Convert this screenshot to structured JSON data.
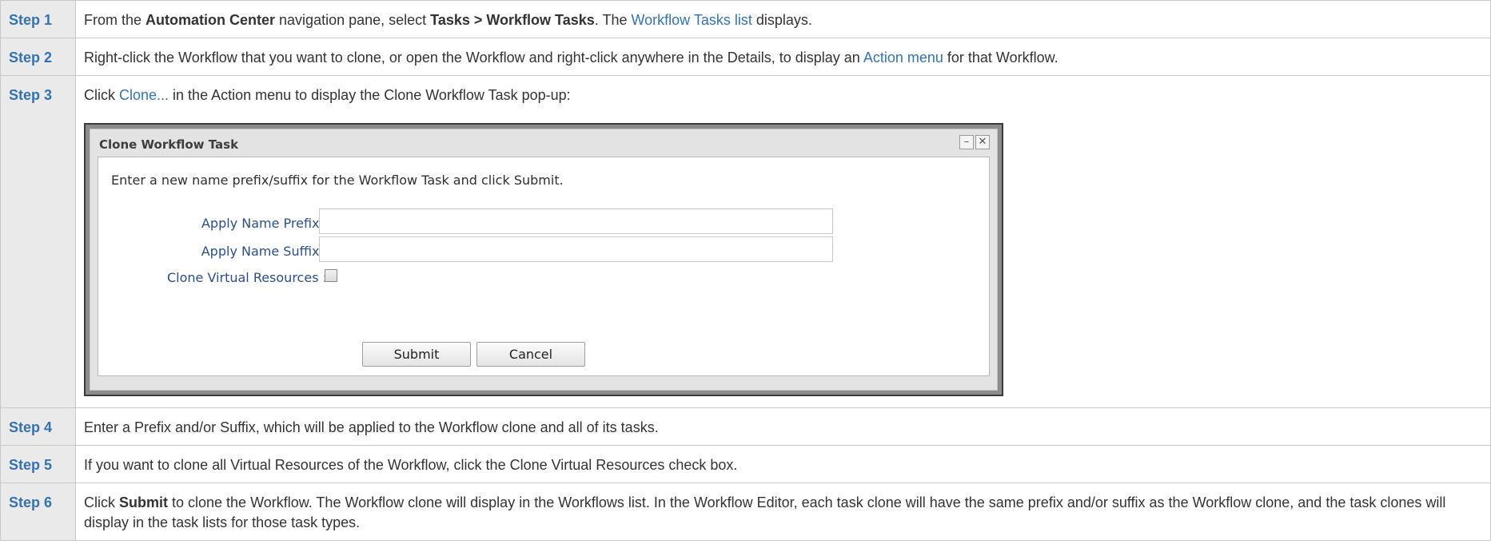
{
  "steps": [
    {
      "label": "Step 1",
      "parts": [
        {
          "t": "From the "
        },
        {
          "t": "Automation Center",
          "b": true
        },
        {
          "t": " navigation pane, select "
        },
        {
          "t": "Tasks > Workflow Tasks",
          "b": true
        },
        {
          "t": ". The "
        },
        {
          "t": "Workflow Tasks list",
          "link": true
        },
        {
          "t": " displays."
        }
      ]
    },
    {
      "label": "Step 2",
      "parts": [
        {
          "t": "Right-click the Workflow that you want to clone, or open the Workflow and right-click anywhere in the Details, to display an "
        },
        {
          "t": "Action menu",
          "link": true
        },
        {
          "t": " for that Workflow."
        }
      ]
    },
    {
      "label": "Step 3",
      "parts": [
        {
          "t": "Click "
        },
        {
          "t": "Clone...",
          "link": true
        },
        {
          "t": " in the Action menu to display the Clone Workflow Task pop-up:"
        }
      ]
    },
    {
      "label": "Step 4",
      "parts": [
        {
          "t": "Enter a Prefix and/or Suffix, which will be applied to the Workflow clone and all of its tasks."
        }
      ]
    },
    {
      "label": "Step 5",
      "parts": [
        {
          "t": "If you want to clone all Virtual Resources of the Workflow, click the Clone Virtual Resources check box."
        }
      ]
    },
    {
      "label": "Step 6",
      "parts": [
        {
          "t": "Click "
        },
        {
          "t": "Submit",
          "b": true
        },
        {
          "t": " to clone the Workflow. The Workflow clone will display in the Workflows list. In the Workflow Editor, each task clone will have the same prefix and/or suffix as the Workflow clone, and the task clones will display in the task lists for those task types."
        }
      ]
    }
  ],
  "dialog": {
    "title": "Clone Workflow Task",
    "minimize_icon": "minimize-icon",
    "close_icon": "close-icon",
    "instruction": "Enter a new name prefix/suffix for the Workflow Task and click Submit.",
    "prefix_label": "Apply Name Prefix :",
    "prefix_value": "",
    "suffix_label": "Apply Name Suffix :",
    "suffix_value": "",
    "clone_vr_label": "Clone Virtual Resources :",
    "clone_vr_checked": false,
    "submit_label": "Submit",
    "cancel_label": "Cancel"
  },
  "colors": {
    "step_label": "#3572b0",
    "link": "#3572b0",
    "step_label_bg": "#eaeaea",
    "border": "#c8c8c8"
  }
}
